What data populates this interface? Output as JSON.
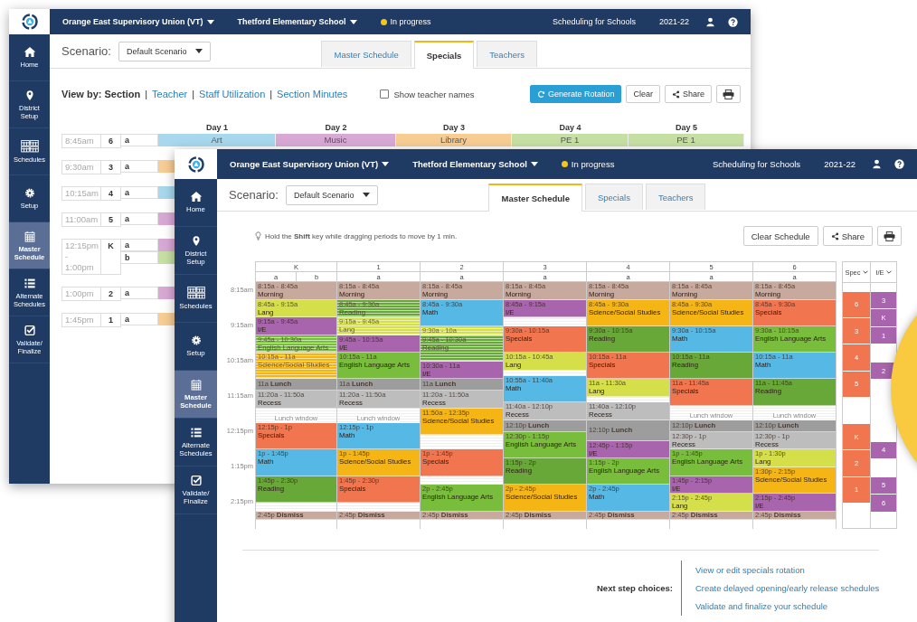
{
  "back_window": {
    "header": {
      "organization": "Orange East Supervisory Union (VT)",
      "school": "Thetford Elementary School",
      "status": "In progress",
      "product": "Scheduling for Schools",
      "year": "2021-22"
    },
    "sidebar": [
      {
        "label": "Home",
        "kind": "home",
        "selected": false
      },
      {
        "label": "District Setup",
        "kind": "pin",
        "selected": false
      },
      {
        "label": "Schedules",
        "kind": "calendars",
        "selected": false
      },
      {
        "label": "Setup",
        "kind": "gear",
        "selected": false
      },
      {
        "label": "Master Schedule",
        "kind": "calendar",
        "selected": true
      },
      {
        "label": "Alternate Schedules",
        "kind": "list",
        "selected": false
      },
      {
        "label": "Validate/ Finalize",
        "kind": "check",
        "selected": false
      }
    ],
    "scenario": {
      "label": "Scenario:",
      "value": "Default Scenario"
    },
    "tabs": [
      {
        "label": "Master Schedule",
        "selected": false
      },
      {
        "label": "Specials",
        "selected": true
      },
      {
        "label": "Teachers",
        "selected": false
      }
    ],
    "view_by": {
      "label": "View by: Section",
      "separator": "|",
      "links": [
        "Teacher",
        "Staff Utilization",
        "Section Minutes"
      ]
    },
    "show_teacher_names": {
      "label": "Show teacher names",
      "checked": false
    },
    "buttons": {
      "generate": "Generate Rotation",
      "clear": "Clear",
      "share": "Share"
    },
    "days": [
      "Day 1",
      "Day 2",
      "Day 3",
      "Day 4",
      "Day 5"
    ],
    "rows": [
      {
        "time": "8:45am",
        "grade": "6",
        "sections": [
          {
            "label": "a",
            "cells": [
              {
                "text": "Art",
                "color": "#a8d8ee"
              },
              {
                "text": "Music",
                "color": "#d9a9d6"
              },
              {
                "text": "Library",
                "color": "#f8cd94"
              },
              {
                "text": "PE 1",
                "color": "#c6e0a4"
              },
              {
                "text": "PE 1",
                "color": "#c6e0a4"
              }
            ]
          }
        ]
      },
      {
        "time": "9:30am",
        "grade": "3",
        "sections": [
          {
            "label": "a",
            "cells": [
              {
                "color": "#f8cd94"
              }
            ]
          }
        ]
      },
      {
        "time": "10:15am",
        "grade": "4",
        "sections": [
          {
            "label": "a",
            "cells": [
              {
                "color": "#a8d8ee"
              }
            ]
          }
        ]
      },
      {
        "time": "11:00am",
        "grade": "5",
        "sections": [
          {
            "label": "a",
            "cells": [
              {
                "color": "#d9a9d6"
              }
            ]
          }
        ]
      },
      {
        "time": "12:15pm - 1:00pm",
        "grade": "K",
        "sections": [
          {
            "label": "a",
            "cells": [
              {
                "color": "#d9a9d6"
              }
            ]
          },
          {
            "label": "b",
            "cells": [
              {
                "color": "#c6e0a4"
              }
            ]
          }
        ]
      },
      {
        "time": "1:00pm",
        "grade": "2",
        "sections": [
          {
            "label": "a",
            "cells": [
              {
                "color": "#d9a9d6"
              }
            ]
          }
        ]
      },
      {
        "time": "1:45pm",
        "grade": "1",
        "sections": [
          {
            "label": "a",
            "cells": [
              {
                "color": "#f8cd94"
              }
            ]
          }
        ]
      }
    ]
  },
  "front_window": {
    "header": {
      "organization": "Orange East Supervisory Union (VT)",
      "school": "Thetford Elementary School",
      "status": "In progress",
      "product": "Scheduling for Schools",
      "year": "2021-22"
    },
    "sidebar": [
      {
        "label": "Home",
        "kind": "home",
        "selected": false
      },
      {
        "label": "District Setup",
        "kind": "pin",
        "selected": false
      },
      {
        "label": "Schedules",
        "kind": "calendars",
        "selected": false
      },
      {
        "label": "Setup",
        "kind": "gear",
        "selected": false
      },
      {
        "label": "Master Schedule",
        "kind": "calendar",
        "selected": true
      },
      {
        "label": "Alternate Schedules",
        "kind": "list",
        "selected": false
      },
      {
        "label": "Validate/ Finalize",
        "kind": "check",
        "selected": false
      }
    ],
    "scenario": {
      "label": "Scenario:",
      "value": "Default Scenario"
    },
    "tabs": [
      {
        "label": "Master Schedule",
        "selected": true
      },
      {
        "label": "Specials",
        "selected": false
      },
      {
        "label": "Teachers",
        "selected": false
      }
    ],
    "hint": "Hold the **Shift** key while dragging periods to move by 1 min.",
    "buttons": {
      "clear": "Clear Schedule",
      "share": "Share"
    },
    "grid": {
      "time_labels": [
        "8:15am",
        "9:15am",
        "10:15am",
        "11:15am",
        "12:15pm",
        "1:15pm",
        "2:15pm"
      ],
      "grades": [
        {
          "label": "K",
          "sections": [
            "a",
            "b"
          ],
          "blocks": [
            {
              "kind": "period",
              "time": "8:15a - 8:45a",
              "title": "Morning",
              "color": "#c8a99d",
              "faded": false
            },
            {
              "kind": "period",
              "time": "8:45a - 9:15a",
              "title": "Lang",
              "color": "#d4df4a",
              "faded": false
            },
            {
              "kind": "period",
              "time": "9:15a - 9:45a",
              "title": "I/E",
              "color": "#a864ad",
              "faded": false
            },
            {
              "kind": "period",
              "time": "9:45a - 10:30a",
              "title": "English Language Arts",
              "color": "#78bd3b",
              "faded": true
            },
            {
              "kind": "period",
              "time": "10:15a - 11a",
              "title": "Science/Social Studies",
              "color": "#f4b515",
              "faded": true
            },
            {
              "kind": "marker",
              "time": "11a",
              "title": "Lunch",
              "color": "#9d9d9d",
              "faded": false
            },
            {
              "kind": "period",
              "time": "11:20a - 11:50a",
              "title": "Recess",
              "color": "#bdbdbd",
              "faded": false
            },
            {
              "kind": "window",
              "title": "Lunch window"
            },
            {
              "kind": "period",
              "time": "12:15p - 1p",
              "title": "Specials",
              "color": "#f1764f",
              "faded": false
            },
            {
              "kind": "period",
              "time": "1p - 1:45p",
              "title": "Math",
              "color": "#55b8e5",
              "faded": false
            },
            {
              "kind": "period",
              "time": "1:45p - 2:30p",
              "title": "Reading",
              "color": "#68a838",
              "faded": false
            },
            {
              "kind": "marker",
              "time": "2:45p",
              "title": "Dismiss",
              "color": "#c8a99d",
              "faded": false
            }
          ]
        },
        {
          "label": "1",
          "sections": [
            "a"
          ],
          "blocks": [
            {
              "kind": "period",
              "time": "8:15a - 8:45a",
              "title": "Morning",
              "color": "#c8a99d",
              "faded": false
            },
            {
              "kind": "period",
              "time": "8:45a - 9:30a",
              "title": "Reading",
              "color": "#68a838",
              "faded": true
            },
            {
              "kind": "period",
              "time": "9:15a - 9:45a",
              "title": "Lang",
              "color": "#d4df4a",
              "faded": true
            },
            {
              "kind": "period",
              "time": "9:45a - 10:15a",
              "title": "I/E",
              "color": "#a864ad",
              "faded": false
            },
            {
              "kind": "period",
              "time": "10:15a - 11a",
              "title": "English Language Arts",
              "color": "#78bd3b",
              "faded": false
            },
            {
              "kind": "marker",
              "time": "11a",
              "title": "Lunch",
              "color": "#9d9d9d",
              "faded": false
            },
            {
              "kind": "period",
              "time": "11:20a - 11:50a",
              "title": "Recess",
              "color": "#bdbdbd",
              "faded": false
            },
            {
              "kind": "window",
              "title": "Lunch window"
            },
            {
              "kind": "period",
              "time": "12:15p - 1p",
              "title": "Math",
              "color": "#55b8e5",
              "faded": false
            },
            {
              "kind": "period",
              "time": "1p - 1:45p",
              "title": "Science/Social Studies",
              "color": "#f4b515",
              "faded": false
            },
            {
              "kind": "period",
              "time": "1:45p - 2:30p",
              "title": "Specials",
              "color": "#f1764f",
              "faded": false
            },
            {
              "kind": "marker",
              "time": "2:45p",
              "title": "Dismiss",
              "color": "#c8a99d",
              "faded": false
            }
          ]
        },
        {
          "label": "2",
          "sections": [
            "a"
          ],
          "blocks": [
            {
              "kind": "period",
              "time": "8:15a - 8:45a",
              "title": "Morning",
              "color": "#c8a99d",
              "faded": false
            },
            {
              "kind": "period",
              "time": "8:45a - 9:30a",
              "title": "Math",
              "color": "#55b8e5",
              "faded": false
            },
            {
              "kind": "period",
              "time": "9:30a - 10a",
              "color": "#d4df4a",
              "faded": true
            },
            {
              "kind": "period",
              "time": "9:45a - 10:30a",
              "title": "Reading",
              "color": "#68a838",
              "faded": true
            },
            {
              "kind": "period",
              "time": "10:30a - 11a",
              "title": "I/E",
              "color": "#a864ad",
              "faded": false
            },
            {
              "kind": "marker",
              "time": "11a",
              "title": "Lunch",
              "color": "#9d9d9d",
              "faded": false
            },
            {
              "kind": "period",
              "time": "11:20a - 11:50a",
              "title": "Recess",
              "color": "#bdbdbd",
              "faded": false
            },
            {
              "kind": "period",
              "time": "11:50a - 12:35p",
              "title": "Science/Social Studies",
              "color": "#f4b515",
              "faded": false
            },
            {
              "kind": "period",
              "time": "1p - 1:45p",
              "title": "Specials",
              "color": "#f1764f",
              "faded": false
            },
            {
              "kind": "period",
              "time": "2p - 2:45p",
              "title": "English Language Arts",
              "color": "#78bd3b",
              "faded": false
            },
            {
              "kind": "marker",
              "time": "2:45p",
              "title": "Dismiss",
              "color": "#c8a99d",
              "faded": false
            }
          ]
        },
        {
          "label": "3",
          "sections": [
            "a"
          ],
          "blocks": [
            {
              "kind": "period",
              "time": "8:15a - 8:45a",
              "title": "Morning",
              "color": "#c8a99d",
              "faded": false
            },
            {
              "kind": "period",
              "time": "8:45a - 9:15a",
              "title": "I/E",
              "color": "#a864ad",
              "faded": false
            },
            {
              "kind": "period",
              "time": "9:30a - 10:15a",
              "title": "Specials",
              "color": "#f1764f",
              "faded": false
            },
            {
              "kind": "period",
              "time": "10:15a - 10:45a",
              "title": "Lang",
              "color": "#d4df4a",
              "faded": false
            },
            {
              "kind": "period",
              "time": "10:55a - 11:40a",
              "title": "Math",
              "color": "#55b8e5",
              "faded": false
            },
            {
              "kind": "period",
              "time": "11:40a - 12:10p",
              "title": "Recess",
              "color": "#bdbdbd",
              "faded": false
            },
            {
              "kind": "marker",
              "time": "12:10p",
              "title": "Lunch",
              "color": "#9d9d9d",
              "faded": false
            },
            {
              "kind": "period",
              "time": "12:30p - 1:15p",
              "title": "English Language Arts",
              "color": "#78bd3b",
              "faded": false
            },
            {
              "kind": "period",
              "time": "1:15p - 2p",
              "title": "Reading",
              "color": "#68a838",
              "faded": false
            },
            {
              "kind": "period",
              "time": "2p - 2:45p",
              "title": "Science/Social Studies",
              "color": "#f4b515",
              "faded": false
            },
            {
              "kind": "marker",
              "time": "2:45p",
              "title": "Dismiss",
              "color": "#c8a99d",
              "faded": false
            }
          ]
        },
        {
          "label": "4",
          "sections": [
            "a"
          ],
          "blocks": [
            {
              "kind": "period",
              "time": "8:15a - 8:45a",
              "title": "Morning",
              "color": "#c8a99d",
              "faded": false
            },
            {
              "kind": "period",
              "time": "8:45a - 9:30a",
              "title": "Science/Social Studies",
              "color": "#f4b515",
              "faded": false
            },
            {
              "kind": "period",
              "time": "9:30a - 10:15a",
              "title": "Reading",
              "color": "#68a838",
              "faded": false
            },
            {
              "kind": "period",
              "time": "10:15a - 11a",
              "title": "Specials",
              "color": "#f1764f",
              "faded": false
            },
            {
              "kind": "period",
              "time": "11a - 11:30a",
              "title": "Lang",
              "color": "#d4df4a",
              "faded": false
            },
            {
              "kind": "period",
              "time": "11:40a - 12:10p",
              "title": "Recess",
              "color": "#bdbdbd",
              "faded": false
            },
            {
              "kind": "marker",
              "time": "12:10p",
              "title": "Lunch",
              "color": "#9d9d9d",
              "faded": false
            },
            {
              "kind": "period",
              "time": "12:45p - 1:15p",
              "title": "I/E",
              "color": "#a864ad",
              "faded": false
            },
            {
              "kind": "period",
              "time": "1:15p - 2p",
              "title": "English Language Arts",
              "color": "#78bd3b",
              "faded": false
            },
            {
              "kind": "period",
              "time": "2p - 2:45p",
              "title": "Math",
              "color": "#55b8e5",
              "faded": false
            },
            {
              "kind": "marker",
              "time": "2:45p",
              "title": "Dismiss",
              "color": "#c8a99d",
              "faded": false
            }
          ]
        },
        {
          "label": "5",
          "sections": [
            "a"
          ],
          "blocks": [
            {
              "kind": "period",
              "time": "8:15a - 8:45a",
              "title": "Morning",
              "color": "#c8a99d",
              "faded": false
            },
            {
              "kind": "period",
              "time": "8:45a - 9:30a",
              "title": "Science/Social Studies",
              "color": "#f4b515",
              "faded": false
            },
            {
              "kind": "period",
              "time": "9:30a - 10:15a",
              "title": "Math",
              "color": "#55b8e5",
              "faded": false
            },
            {
              "kind": "period",
              "time": "10:15a - 11a",
              "title": "Reading",
              "color": "#68a838",
              "faded": false
            },
            {
              "kind": "period",
              "time": "11a - 11:45a",
              "title": "Specials",
              "color": "#f1764f",
              "faded": false
            },
            {
              "kind": "window",
              "title": "Lunch window"
            },
            {
              "kind": "marker",
              "time": "12:10p",
              "title": "Lunch",
              "color": "#9d9d9d",
              "faded": false
            },
            {
              "kind": "period",
              "time": "12:30p - 1p",
              "title": "Recess",
              "color": "#bdbdbd",
              "faded": false
            },
            {
              "kind": "period",
              "time": "1p - 1:45p",
              "title": "English Language Arts",
              "color": "#78bd3b",
              "faded": false
            },
            {
              "kind": "period",
              "time": "1:45p - 2:15p",
              "title": "I/E",
              "color": "#a864ad",
              "faded": false
            },
            {
              "kind": "period",
              "time": "2:15p - 2:45p",
              "title": "Lang",
              "color": "#d4df4a",
              "faded": false
            },
            {
              "kind": "marker",
              "time": "2:45p",
              "title": "Dismiss",
              "color": "#c8a99d",
              "faded": false
            }
          ]
        },
        {
          "label": "6",
          "sections": [
            "a"
          ],
          "blocks": [
            {
              "kind": "period",
              "time": "8:15a - 8:45a",
              "title": "Morning",
              "color": "#c8a99d",
              "faded": false
            },
            {
              "kind": "period",
              "time": "8:45a - 9:30a",
              "title": "Specials",
              "color": "#f1764f",
              "faded": false
            },
            {
              "kind": "period",
              "time": "9:30a - 10:15a",
              "title": "English Language Arts",
              "color": "#78bd3b",
              "faded": false
            },
            {
              "kind": "period",
              "time": "10:15a - 11a",
              "title": "Math",
              "color": "#55b8e5",
              "faded": false
            },
            {
              "kind": "period",
              "time": "11a - 11:45a",
              "title": "Reading",
              "color": "#68a838",
              "faded": false
            },
            {
              "kind": "window",
              "title": "Lunch window"
            },
            {
              "kind": "marker",
              "time": "12:10p",
              "title": "Lunch",
              "color": "#9d9d9d",
              "faded": false
            },
            {
              "kind": "period",
              "time": "12:30p - 1p",
              "title": "Recess",
              "color": "#bdbdbd",
              "faded": false
            },
            {
              "kind": "period",
              "time": "1p - 1:30p",
              "title": "Lang",
              "color": "#d4df4a",
              "faded": false
            },
            {
              "kind": "period",
              "time": "1:30p - 2:15p",
              "title": "Science/Social Studies",
              "color": "#f4b515",
              "faded": false
            },
            {
              "kind": "period",
              "time": "2:15p - 2:45p",
              "title": "I/E",
              "color": "#a864ad",
              "faded": false
            },
            {
              "kind": "marker",
              "time": "2:45p",
              "title": "Dismiss",
              "color": "#c8a99d",
              "faded": false
            }
          ]
        }
      ]
    },
    "side_panel": {
      "spec": {
        "label": "Spec",
        "cells": [
          "6",
          "3",
          "4",
          "5",
          "K",
          "2",
          "1"
        ]
      },
      "ie": {
        "label": "I/E",
        "cells": [
          "3",
          "K",
          "1",
          "2",
          "4",
          "5",
          "6"
        ]
      }
    },
    "next_steps": {
      "label": "Next step choices:",
      "links": [
        "View or edit specials rotation",
        "Create delayed opening/early release schedules",
        "Validate and finalize your schedule"
      ]
    }
  }
}
